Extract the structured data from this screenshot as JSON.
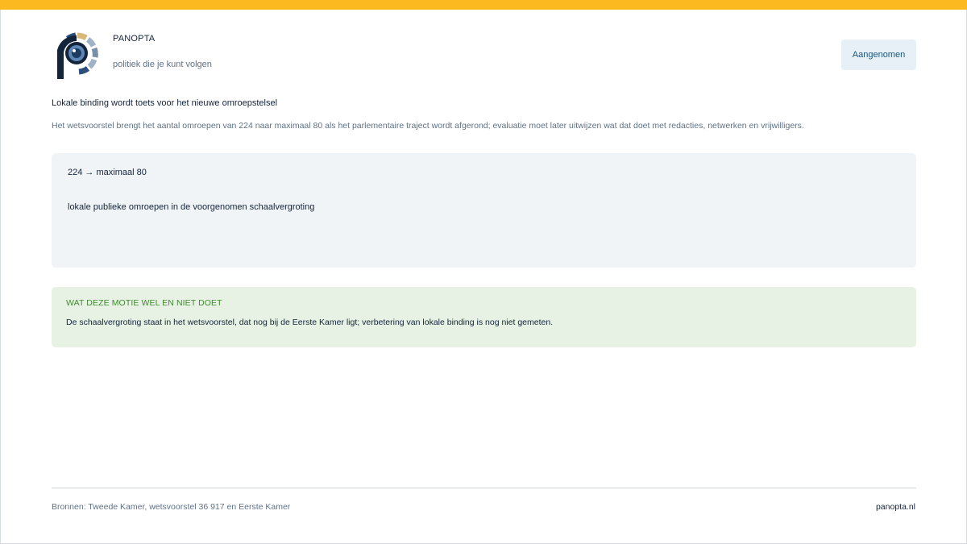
{
  "brand": {
    "name": "PANOPTA",
    "tagline": "politiek die je kunt volgen",
    "logo_icon": "panopta-eye-logo-icon",
    "colors": {
      "navy": "#13243b",
      "blue": "#2c4e7a",
      "gold": "#d9b77a",
      "accent_bar": "#fdb920"
    }
  },
  "status": {
    "label": "Aangenomen"
  },
  "article": {
    "headline": "Lokale binding wordt toets voor het nieuwe omroepstelsel",
    "summary": "Het wetsvoorstel brengt het aantal omroepen van 224 naar maximaal 80 als het parlementaire traject wordt afgerond; evaluatie moet later uitwijzen wat dat doet met redacties, netwerken en vrijwilligers."
  },
  "stat": {
    "value": "224 → maximaal 80",
    "label": "lokale publieke omroepen in de voorgenomen schaalvergroting"
  },
  "note": {
    "title": "WAT DEZE MOTIE WEL EN NIET DOET",
    "text": "De schaalvergroting staat in het wetsvoorstel, dat nog bij de Eerste Kamer ligt; verbetering van lokale binding is nog niet gemeten.",
    "color": "#3f8a2e",
    "background": "#e7f2e4"
  },
  "footer": {
    "sources": "Bronnen: Tweede Kamer, wetsvoorstel 36 917 en Eerste Kamer",
    "site": "panopta.nl"
  }
}
